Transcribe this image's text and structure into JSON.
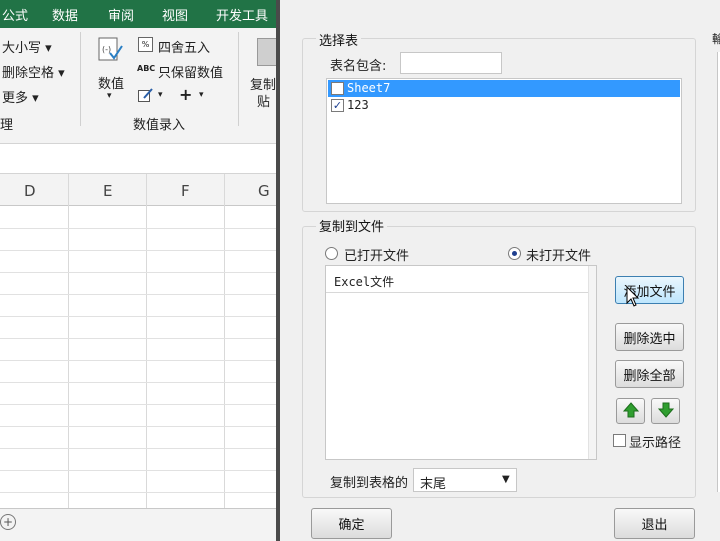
{
  "excel": {
    "ribbon_tabs": [
      "公式",
      "数据",
      "审阅",
      "视图",
      "开发工具"
    ],
    "ribbon": {
      "size": "大小写",
      "delete_space": "删除空格",
      "more": "更多",
      "group_partial": "理",
      "value_btn": "数值",
      "round": "四舍五入",
      "keep_value": "只保留数值",
      "plus": "+",
      "value_entry_group": "数值录入",
      "copy_partial": "复制",
      "paste_partial": "贴"
    },
    "columns": [
      "D",
      "E",
      "F",
      "G"
    ]
  },
  "dialog": {
    "select_sheet_group": "选择表",
    "name_contains_label": "表名包含:",
    "name_contains_value": "",
    "sheets": [
      {
        "name": "Sheet7",
        "checked": false,
        "selected": true
      },
      {
        "name": "123",
        "checked": true,
        "selected": false
      }
    ],
    "copy_to_file_group": "复制到文件",
    "radio_opened": "已打开文件",
    "radio_unopened": "未打开文件",
    "file_list_header": "Excel文件",
    "add_file_button": "添加文件",
    "delete_selected_button": "删除选中",
    "delete_all_button": "删除全部",
    "show_path_label": "显示路径",
    "copy_to_position_label": "复制到表格的",
    "copy_to_position_value": "末尾",
    "ok_button": "确定",
    "exit_button": "退出",
    "right_partial_label": "輸"
  }
}
